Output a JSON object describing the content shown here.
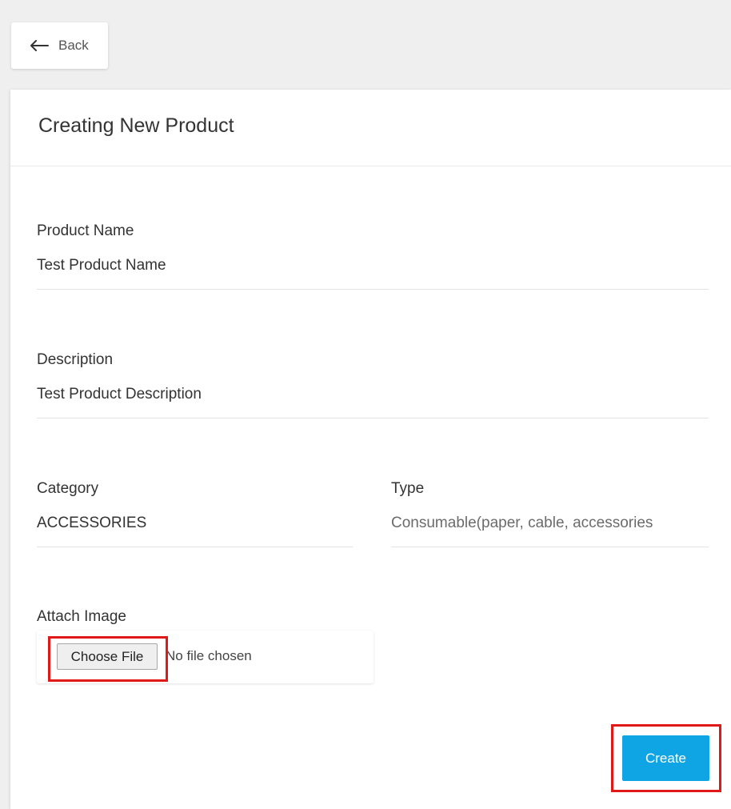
{
  "nav": {
    "back_label": "Back",
    "back_icon": "arrow-left-icon"
  },
  "card": {
    "title": "Creating New Product"
  },
  "form": {
    "product_name": {
      "label": "Product Name",
      "value": "Test Product Name"
    },
    "description": {
      "label": "Description",
      "value": "Test Product Description"
    },
    "category": {
      "label": "Category",
      "value": "ACCESSORIES"
    },
    "type": {
      "label": "Type",
      "value": "Consumable(paper, cable, accessories"
    },
    "attach_image": {
      "label": "Attach Image",
      "button_label": "Choose File",
      "status": "No file chosen"
    },
    "submit_label": "Create"
  },
  "colors": {
    "page_background": "#efefef",
    "card_background": "#ffffff",
    "accent": "#0fa4e3",
    "highlight": "#e01818"
  }
}
